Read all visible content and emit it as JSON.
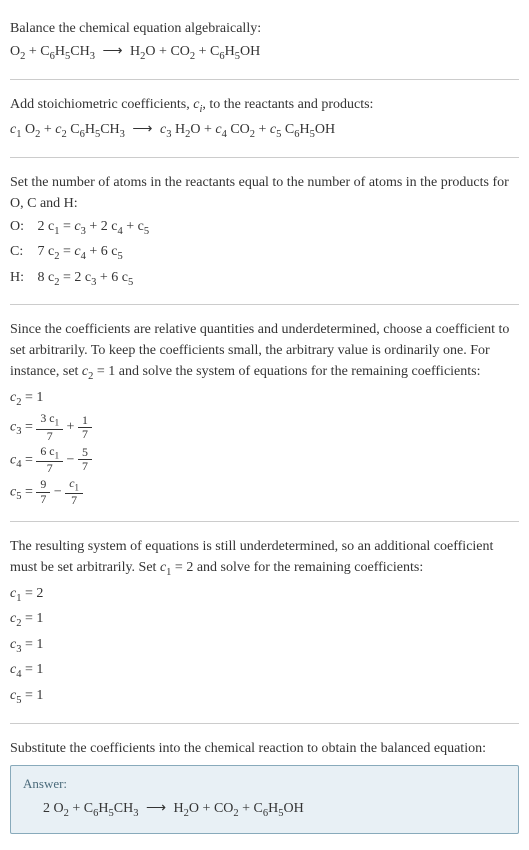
{
  "section1": {
    "intro": "Balance the chemical equation algebraically:"
  },
  "section2": {
    "intro_pre": "Add stoichiometric coefficients, ",
    "intro_ci": "c",
    "intro_i": "i",
    "intro_post": ", to the reactants and products:"
  },
  "section3": {
    "intro": "Set the number of atoms in the reactants equal to the number of atoms in the products for O, C and H:",
    "o_label": "O: ",
    "c_label": "C: ",
    "h_label": "H: "
  },
  "section4": {
    "intro_pre": "Since the coefficients are relative quantities and underdetermined, choose a coefficient to set arbitrarily. To keep the coefficients small, the arbitrary value is ordinarily one. For instance, set ",
    "intro_c2": "c",
    "intro_sub2": "2",
    "intro_post": " = 1 and solve the system of equations for the remaining coefficients:",
    "eq1": " = 1",
    "eq2_mid": " = ",
    "eq2_plus": " + ",
    "eq3_mid": " = ",
    "eq3_minus": " − ",
    "eq4_mid": " = ",
    "eq4_minus": " − ",
    "f1n": "3 c",
    "f1n1": "1",
    "f1d": "7",
    "f2n": "1",
    "f2d": "7",
    "f3n": "6 c",
    "f3n1": "1",
    "f3d": "7",
    "f4n": "5",
    "f4d": "7",
    "f5n": "9",
    "f5d": "7",
    "f6n": "c",
    "f6n1": "1",
    "f6d": "7"
  },
  "section5": {
    "intro_pre": "The resulting system of equations is still underdetermined, so an additional coefficient must be set arbitrarily. Set ",
    "intro_c1": "c",
    "intro_sub1": "1",
    "intro_post": " = 2 and solve for the remaining coefficients:",
    "v1": " = 2",
    "v2": " = 1",
    "v3": " = 1",
    "v4": " = 1",
    "v5": " = 1"
  },
  "section6": {
    "intro": "Substitute the coefficients into the chemical reaction to obtain the balanced equation:",
    "answer_label": "Answer:"
  },
  "chem": {
    "O": "O",
    "C": "C",
    "H": "H",
    "CH": "CH",
    "CO": "CO",
    "OH": "OH",
    "c": "c",
    "s1": "1",
    "s2": "2",
    "s3": "3",
    "s4": "4",
    "s5": "5",
    "s6": "6",
    "s7": "7",
    "s8": "8",
    "plus": " + ",
    "arrow": "⟶",
    "two_coef": "2 ",
    "eq_2c1": "2 c",
    "eq_eq": " = ",
    "eq_c": "c",
    "eq_plus2c": " + 2 c",
    "eq_plusc": " + c",
    "eq_7c": "7 c",
    "eq_plus6c": " + 6 c",
    "eq_8c": "8 c",
    "eq_2c": "2 c"
  }
}
